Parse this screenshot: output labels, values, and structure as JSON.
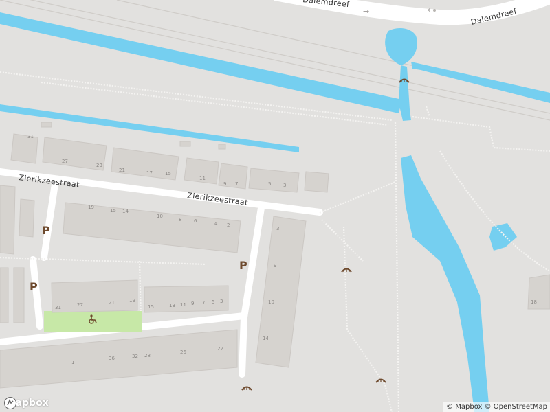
{
  "map": {
    "colors": {
      "land": "#e2e1df",
      "water": "#75cff0",
      "road": "#ffffff",
      "building": "#d6d3cf",
      "park": "#c7e8a7",
      "poi": "#6e4a2e"
    },
    "streets": [
      {
        "name": "Zierikzeestraat",
        "context": "west"
      },
      {
        "name": "Zierikzeestraat",
        "context": "middle"
      },
      {
        "name": "Dalemdreef",
        "context": "top"
      },
      {
        "name": "Dalemdreef",
        "context": "top-right"
      }
    ],
    "parking_label": "P",
    "house_numbers": [
      "31",
      "27",
      "23",
      "21",
      "17",
      "15",
      "11",
      "9",
      "7",
      "5",
      "3",
      "19",
      "15",
      "14",
      "10",
      "8",
      "6",
      "4",
      "2",
      "3",
      "9",
      "10",
      "14",
      "31",
      "27",
      "21",
      "19",
      "15",
      "13",
      "11",
      "9",
      "7",
      "5",
      "3",
      "1",
      "36",
      "32",
      "28",
      "26",
      "22",
      "18",
      "61"
    ],
    "icons": [
      "bridge-icon",
      "wheelchair-icon",
      "mapbox-logo-icon"
    ]
  },
  "branding": {
    "logo_text": "mapbox"
  },
  "attribution": {
    "text": "© Mapbox © OpenStreetMap"
  }
}
